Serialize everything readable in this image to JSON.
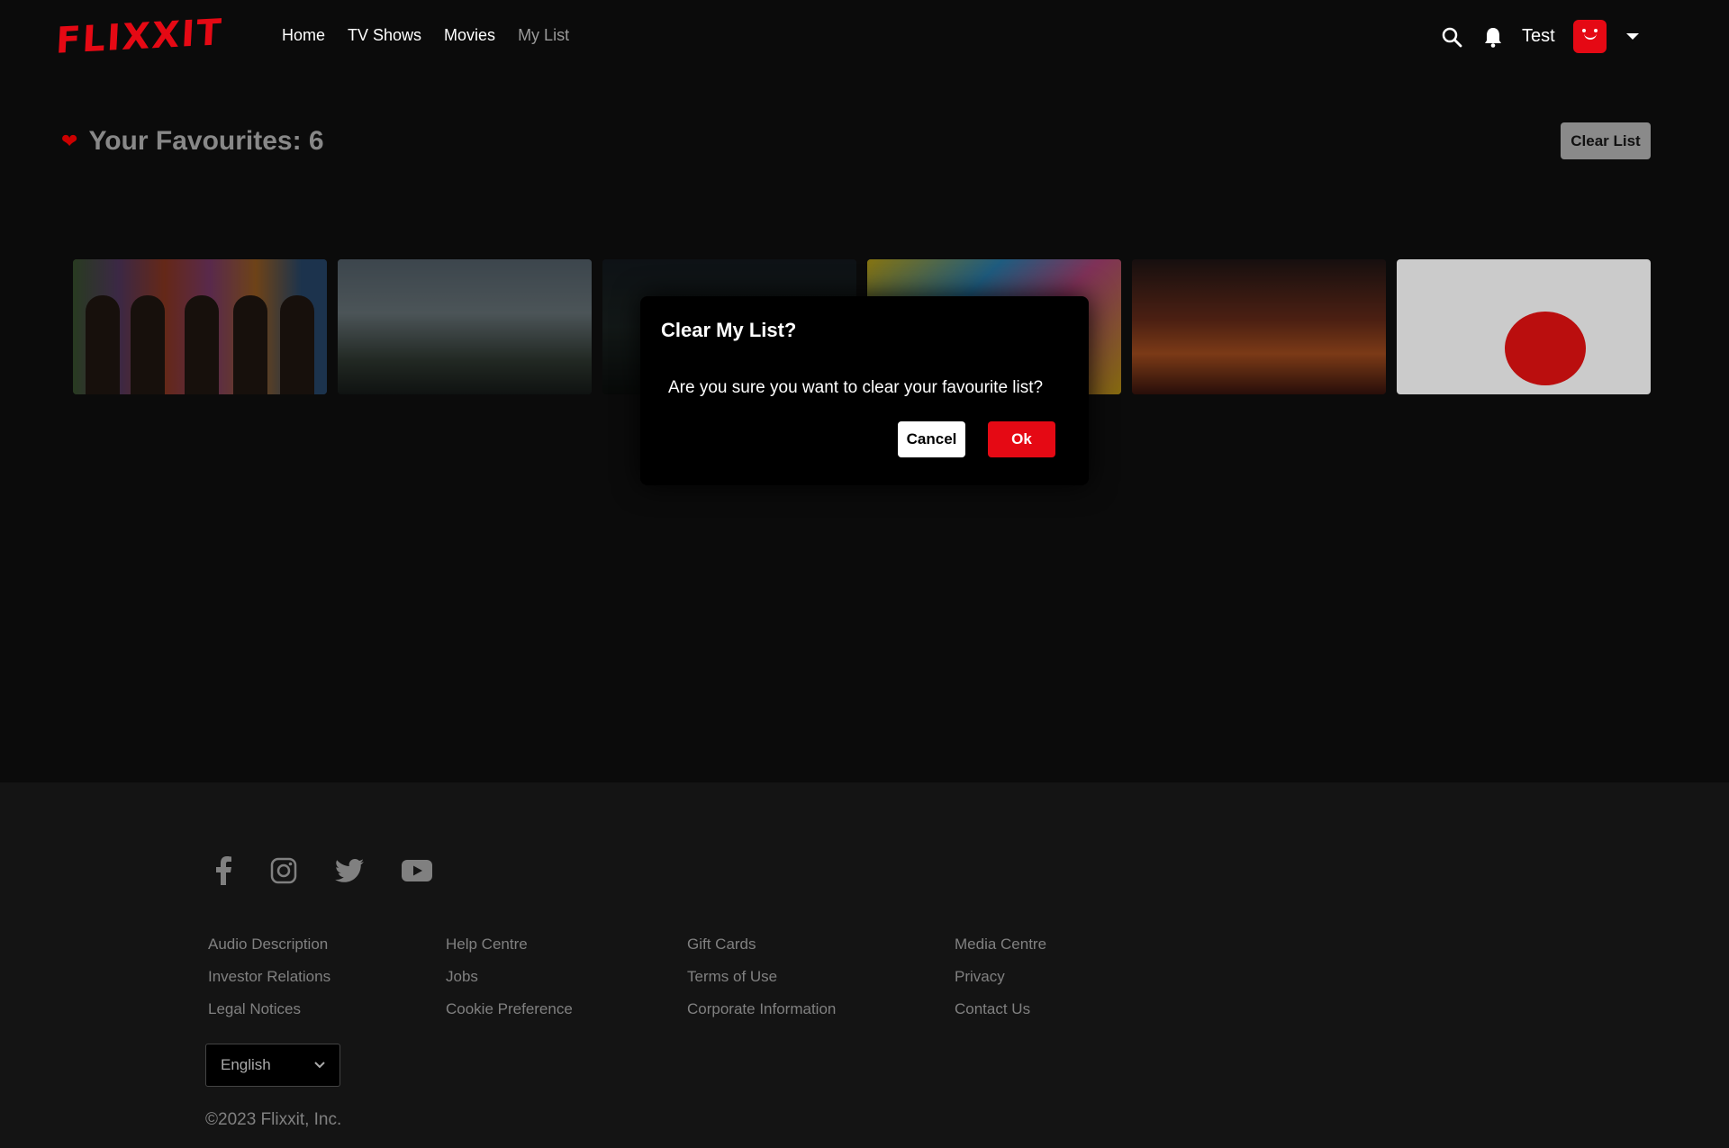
{
  "header": {
    "logo": "FLIXXIT",
    "nav": [
      "Home",
      "TV Shows",
      "Movies",
      "My List"
    ],
    "username": "Test"
  },
  "favourites": {
    "title": "Your Favourites: 6",
    "clear_button": "Clear List"
  },
  "modal": {
    "title": "Clear My List?",
    "message": "Are you sure you want to clear your favourite list?",
    "cancel": "Cancel",
    "ok": "Ok"
  },
  "footer": {
    "social": [
      "facebook-icon",
      "instagram-icon",
      "twitter-icon",
      "youtube-icon"
    ],
    "columns": [
      [
        "Audio Description",
        "Investor Relations",
        "Legal Notices"
      ],
      [
        "Help Centre",
        "Jobs",
        "Cookie Preference"
      ],
      [
        "Gift Cards",
        "Terms of Use",
        "Corporate Information"
      ],
      [
        "Media Centre",
        "Privacy",
        "Contact Us"
      ]
    ],
    "language": "English",
    "copyright": "©2023 Flixxit, Inc."
  },
  "colors": {
    "brand": "#e50914",
    "background": "#0b0b0b",
    "footer": "#141414"
  }
}
